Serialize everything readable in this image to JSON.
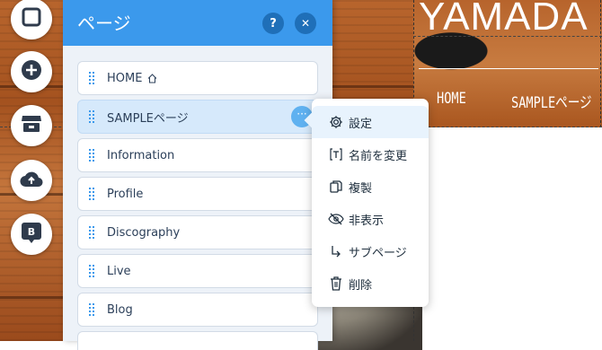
{
  "site": {
    "title": "YAMADA",
    "nav": [
      "HOME",
      "SAMPLEページ"
    ]
  },
  "toolbar": {
    "buttons": [
      {
        "name": "pages-icon"
      },
      {
        "name": "add-icon"
      },
      {
        "name": "store-icon"
      },
      {
        "name": "upload-icon"
      },
      {
        "name": "blog-icon",
        "text": "B"
      }
    ]
  },
  "panel": {
    "title": "ページ",
    "help_label": "?",
    "close_label": "✕",
    "pages": [
      {
        "label": "HOME",
        "home": true
      },
      {
        "label": "SAMPLEページ",
        "selected": true
      },
      {
        "label": "Information"
      },
      {
        "label": "Profile"
      },
      {
        "label": "Discography"
      },
      {
        "label": "Live"
      },
      {
        "label": "Blog"
      }
    ],
    "more_label": "···"
  },
  "context_menu": {
    "items": [
      {
        "icon": "gear-icon",
        "label": "設定"
      },
      {
        "icon": "rename-icon",
        "label": "名前を変更"
      },
      {
        "icon": "duplicate-icon",
        "label": "複製"
      },
      {
        "icon": "hide-icon",
        "label": "非表示"
      },
      {
        "icon": "subpage-icon",
        "label": "サブページ"
      },
      {
        "icon": "trash-icon",
        "label": "削除"
      }
    ]
  },
  "colors": {
    "panel_header": "#3b99ec",
    "selected_row": "#d6e9fb",
    "accent": "#3b99ec"
  }
}
